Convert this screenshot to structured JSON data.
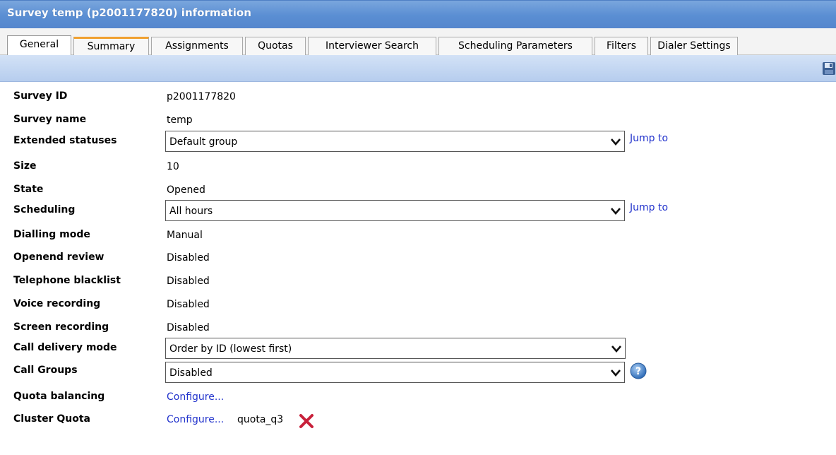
{
  "window": {
    "title": "Survey temp (p2001177820) information"
  },
  "tabs": [
    {
      "label": "General"
    },
    {
      "label": "Summary"
    },
    {
      "label": "Assignments"
    },
    {
      "label": "Quotas"
    },
    {
      "label": "Interviewer Search"
    },
    {
      "label": "Scheduling Parameters"
    },
    {
      "label": "Filters"
    },
    {
      "label": "Dialer Settings"
    }
  ],
  "toolbar": {
    "save_icon": "save-icon"
  },
  "fields": {
    "survey_id": {
      "label": "Survey ID",
      "value": "p2001177820"
    },
    "survey_name": {
      "label": "Survey name",
      "value": "temp"
    },
    "extended_statuses": {
      "label": "Extended statuses",
      "value": "Default group",
      "link": "Jump to"
    },
    "size": {
      "label": "Size",
      "value": "10"
    },
    "state": {
      "label": "State",
      "value": "Opened"
    },
    "scheduling": {
      "label": "Scheduling",
      "value": "All hours",
      "link": "Jump to"
    },
    "dialling_mode": {
      "label": "Dialling mode",
      "value": "Manual"
    },
    "openend_review": {
      "label": "Openend review",
      "value": "Disabled"
    },
    "telephone_blacklist": {
      "label": "Telephone blacklist",
      "value": "Disabled"
    },
    "voice_recording": {
      "label": "Voice recording",
      "value": "Disabled"
    },
    "screen_recording": {
      "label": "Screen recording",
      "value": "Disabled"
    },
    "call_delivery_mode": {
      "label": "Call delivery mode",
      "value": "Order by ID (lowest first)"
    },
    "call_groups": {
      "label": "Call Groups",
      "value": "Disabled"
    },
    "quota_balancing": {
      "label": "Quota balancing",
      "link": "Configure..."
    },
    "cluster_quota": {
      "label": "Cluster Quota",
      "link": "Configure...",
      "value": "quota_q3"
    }
  },
  "colors": {
    "title_bar": "#5a8ed3",
    "toolbar": "#c4d7f1",
    "link": "#2233cc",
    "delete": "#c8203a",
    "help": "#3a79c4"
  }
}
